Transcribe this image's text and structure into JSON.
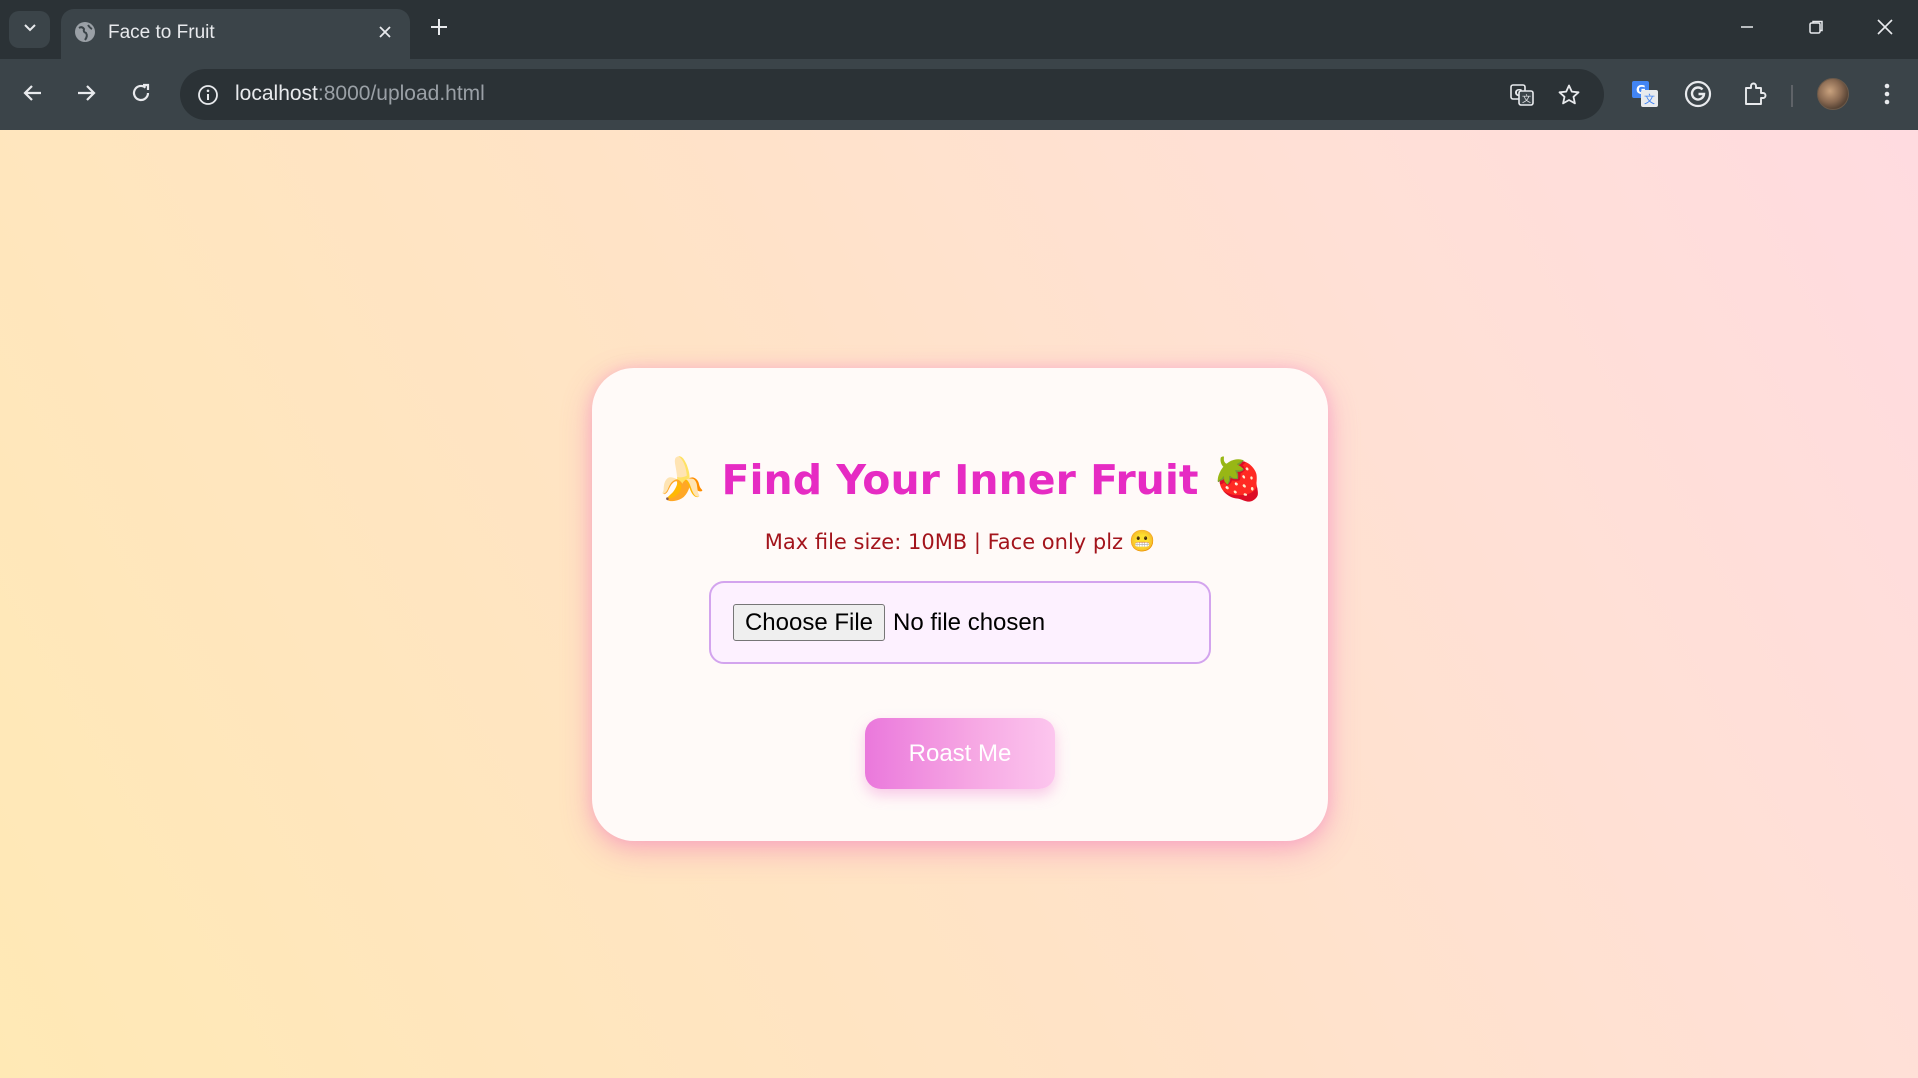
{
  "browser": {
    "tab_title": "Face to Fruit",
    "url_host": "localhost",
    "url_rest": ":8000/upload.html"
  },
  "page": {
    "title": "Find Your Inner Fruit",
    "title_emoji_left": "🍌",
    "title_emoji_right": "🍓",
    "subtitle": "Max file size: 10MB | Face only plz",
    "subtitle_emoji": "😬",
    "file_input": {
      "button_label": "Choose File",
      "status": "No file chosen"
    },
    "submit_label": "Roast Me"
  },
  "colors": {
    "title": "#e62bc3",
    "subtitle": "#a3141c",
    "accent": "#ea78dc"
  },
  "icons": {
    "tab_search": "chevron-down-icon",
    "favicon": "globe-icon",
    "tab_close": "close-icon",
    "new_tab": "plus-icon",
    "back": "arrow-left-icon",
    "forward": "arrow-right-icon",
    "reload": "reload-icon",
    "site_info": "info-icon",
    "translate": "translate-icon",
    "bookmark": "star-icon",
    "ext_translate": "google-translate-icon",
    "grammarly": "grammarly-icon",
    "extensions": "puzzle-icon",
    "menu": "kebab-menu-icon"
  }
}
